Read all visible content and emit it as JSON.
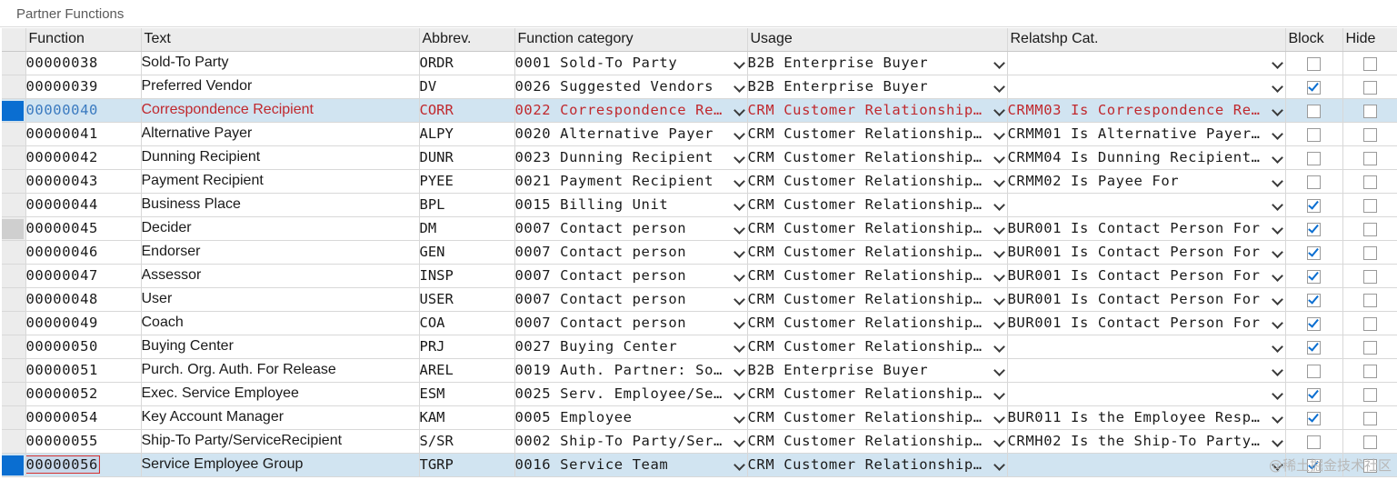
{
  "title": "Partner Functions",
  "columns": [
    "Function",
    "Text",
    "Abbrev.",
    "Function category",
    "Usage",
    "Relatshp Cat.",
    "Block",
    "Hide"
  ],
  "rows": [
    {
      "function": "00000038",
      "text": "Sold-To Party",
      "abbrev": "ORDR",
      "category": "0001 Sold-To Party",
      "usage": "B2B Enterprise Buyer",
      "relcat": "",
      "block": false,
      "hide": false,
      "state": ""
    },
    {
      "function": "00000039",
      "text": "Preferred Vendor",
      "abbrev": "DV",
      "category": "0026 Suggested Vendors",
      "usage": "B2B Enterprise Buyer",
      "relcat": "",
      "block": true,
      "hide": false,
      "state": ""
    },
    {
      "function": "00000040",
      "text": "Correspondence Recipient",
      "abbrev": "CORR",
      "category": "0022 Correspondence Re…",
      "usage": "CRM Customer Relationship…",
      "relcat": "CRMM03 Is Correspondence Re…",
      "block": false,
      "hide": false,
      "state": "highlight"
    },
    {
      "function": "00000041",
      "text": "Alternative Payer",
      "abbrev": "ALPY",
      "category": "0020 Alternative Payer",
      "usage": "CRM Customer Relationship…",
      "relcat": "CRMM01 Is Alternative Payer…",
      "block": false,
      "hide": false,
      "state": ""
    },
    {
      "function": "00000042",
      "text": "Dunning Recipient",
      "abbrev": "DUNR",
      "category": "0023 Dunning Recipient",
      "usage": "CRM Customer Relationship…",
      "relcat": "CRMM04 Is Dunning Recipient…",
      "block": false,
      "hide": false,
      "state": ""
    },
    {
      "function": "00000043",
      "text": "Payment Recipient",
      "abbrev": "PYEE",
      "category": "0021 Payment Recipient",
      "usage": "CRM Customer Relationship…",
      "relcat": "CRMM02 Is Payee For",
      "block": false,
      "hide": false,
      "state": ""
    },
    {
      "function": "00000044",
      "text": "Business Place",
      "abbrev": "BPL",
      "category": "0015 Billing Unit",
      "usage": "CRM Customer Relationship…",
      "relcat": "",
      "block": true,
      "hide": false,
      "state": ""
    },
    {
      "function": "00000045",
      "text": "Decider",
      "abbrev": "DM",
      "category": "0007 Contact person",
      "usage": "CRM Customer Relationship…",
      "relcat": "BUR001 Is Contact Person For",
      "block": true,
      "hide": false,
      "state": "gray"
    },
    {
      "function": "00000046",
      "text": "Endorser",
      "abbrev": "GEN",
      "category": "0007 Contact person",
      "usage": "CRM Customer Relationship…",
      "relcat": "BUR001 Is Contact Person For",
      "block": true,
      "hide": false,
      "state": ""
    },
    {
      "function": "00000047",
      "text": "Assessor",
      "abbrev": "INSP",
      "category": "0007 Contact person",
      "usage": "CRM Customer Relationship…",
      "relcat": "BUR001 Is Contact Person For",
      "block": true,
      "hide": false,
      "state": ""
    },
    {
      "function": "00000048",
      "text": "User",
      "abbrev": "USER",
      "category": "0007 Contact person",
      "usage": "CRM Customer Relationship…",
      "relcat": "BUR001 Is Contact Person For",
      "block": true,
      "hide": false,
      "state": ""
    },
    {
      "function": "00000049",
      "text": "Coach",
      "abbrev": "COA",
      "category": "0007 Contact person",
      "usage": "CRM Customer Relationship…",
      "relcat": "BUR001 Is Contact Person For",
      "block": true,
      "hide": false,
      "state": ""
    },
    {
      "function": "00000050",
      "text": "Buying Center",
      "abbrev": "PRJ",
      "category": "0027 Buying Center",
      "usage": "CRM Customer Relationship…",
      "relcat": "",
      "block": true,
      "hide": false,
      "state": ""
    },
    {
      "function": "00000051",
      "text": "Purch. Org. Auth. For Release",
      "abbrev": "AREL",
      "category": "0019 Auth. Partner: So…",
      "usage": "B2B Enterprise Buyer",
      "relcat": "",
      "block": false,
      "hide": false,
      "state": ""
    },
    {
      "function": "00000052",
      "text": "Exec. Service Employee",
      "abbrev": "ESM",
      "category": "0025 Serv. Employee/Se…",
      "usage": "CRM Customer Relationship…",
      "relcat": "",
      "block": true,
      "hide": false,
      "state": ""
    },
    {
      "function": "00000054",
      "text": "Key Account Manager",
      "abbrev": "KAM",
      "category": "0005 Employee",
      "usage": "CRM Customer Relationship…",
      "relcat": "BUR011 Is the Employee Resp…",
      "block": true,
      "hide": false,
      "state": ""
    },
    {
      "function": "00000055",
      "text": "Ship-To Party/ServiceRecipient",
      "abbrev": "S/SR",
      "category": "0002 Ship-To Party/Ser…",
      "usage": "CRM Customer Relationship…",
      "relcat": "CRMH02 Is the Ship-To Party…",
      "block": false,
      "hide": false,
      "state": ""
    },
    {
      "function": "00000056",
      "text": "Service Employee Group",
      "abbrev": "TGRP",
      "category": "0016 Service Team",
      "usage": "CRM Customer Relationship…",
      "relcat": "",
      "block": true,
      "hide": false,
      "state": "focused"
    }
  ],
  "watermark": "@稀土掘金技术社区"
}
